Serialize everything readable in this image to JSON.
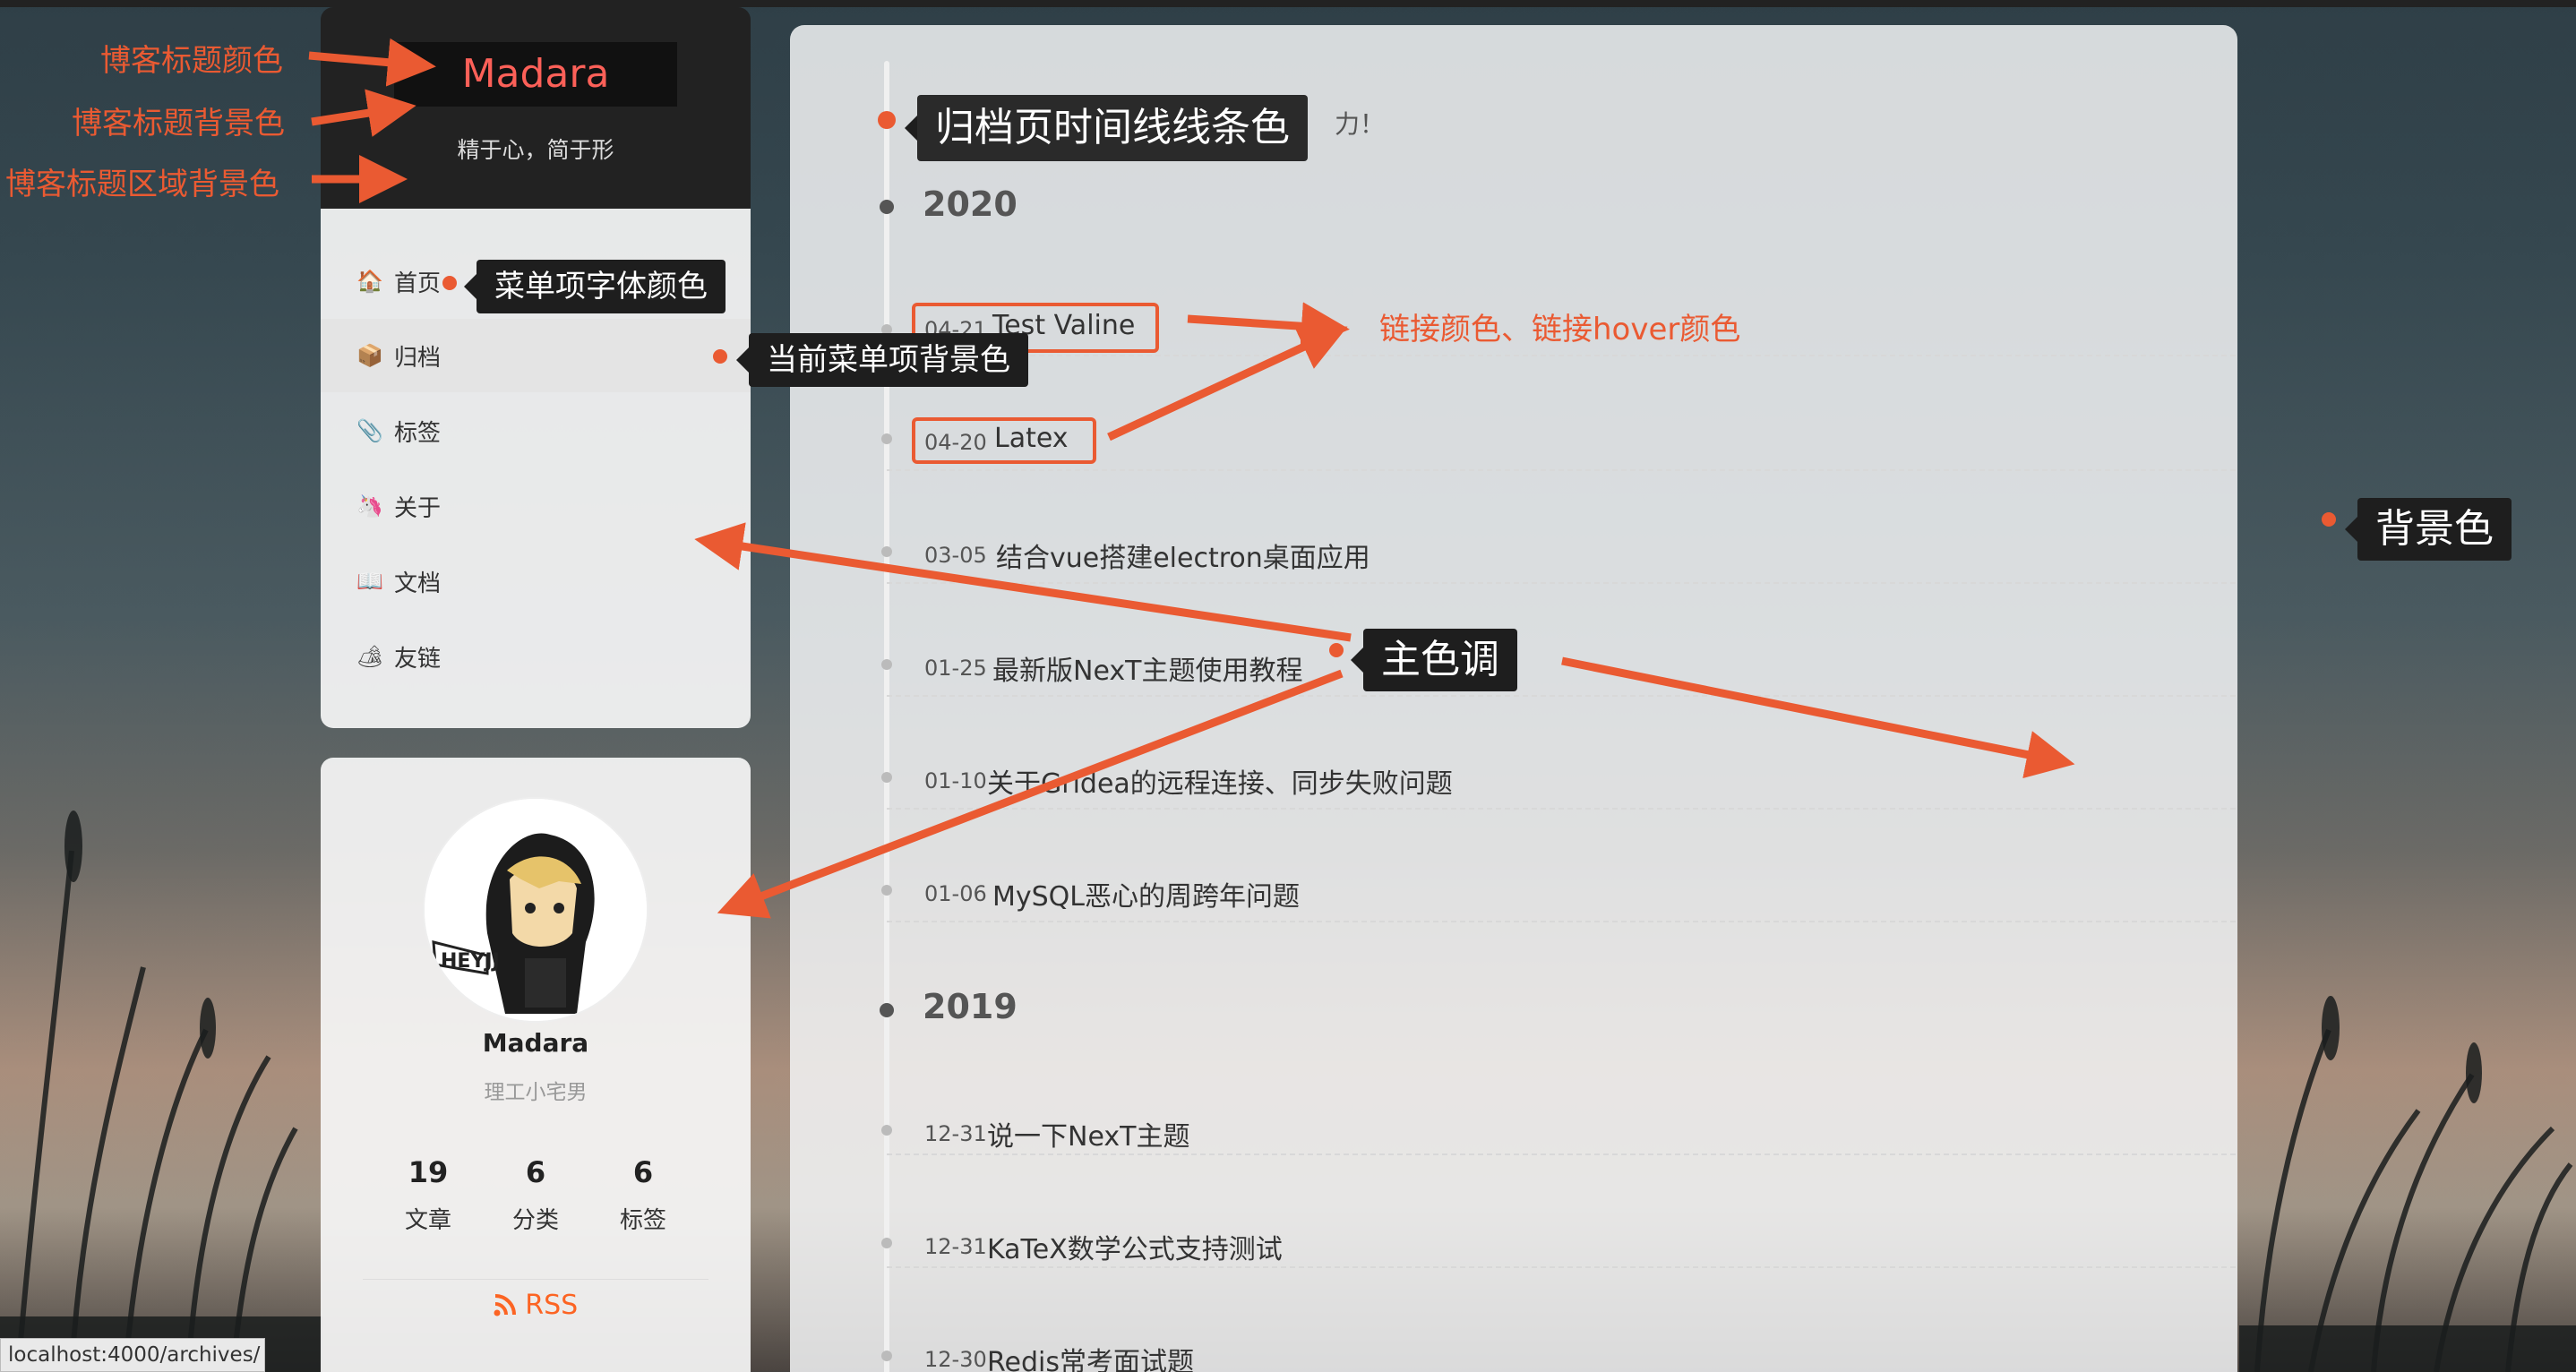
{
  "colors": {
    "accent": "#ea5a32",
    "brand_text": "#fc6058",
    "brand_bg": "#111111",
    "header_bg": "#222222",
    "link": "#fc6423"
  },
  "site": {
    "brand": "Madara",
    "subtitle": "精于心，简于形"
  },
  "menu": [
    {
      "icon": "house-icon",
      "glyph": "🏠",
      "label": "首页"
    },
    {
      "icon": "package-icon",
      "glyph": "📦",
      "label": "归档"
    },
    {
      "icon": "paperclip-icon",
      "glyph": "📎",
      "label": "标签"
    },
    {
      "icon": "unicorn-icon",
      "glyph": "🦄",
      "label": "关于"
    },
    {
      "icon": "book-icon",
      "glyph": "📖",
      "label": "文档"
    },
    {
      "icon": "camping-icon",
      "glyph": "🏕",
      "label": "友链"
    }
  ],
  "profile": {
    "name": "Madara",
    "description": "理工小宅男",
    "stats": [
      {
        "value": "19",
        "label": "文章"
      },
      {
        "value": "6",
        "label": "分类"
      },
      {
        "value": "6",
        "label": "标签"
      }
    ],
    "rss": "RSS"
  },
  "archive": {
    "intro": "力！",
    "years": [
      {
        "year": "2020",
        "posts": [
          {
            "date": "04-21",
            "title": "Test Valine"
          },
          {
            "date": "04-20",
            "title": "Latex"
          },
          {
            "date": "03-05",
            "title": "结合vue搭建electron桌面应用"
          },
          {
            "date": "01-25",
            "title": "最新版NexT主题使用教程"
          },
          {
            "date": "01-10",
            "title": "关于Gridea的远程连接、同步失败问题"
          },
          {
            "date": "01-06",
            "title": "MySQL恶心的周跨年问题"
          }
        ]
      },
      {
        "year": "2019",
        "posts": [
          {
            "date": "12-31",
            "title": "说一下NexT主题"
          },
          {
            "date": "12-31",
            "title": "KaTeX数学公式支持测试"
          },
          {
            "date": "12-30",
            "title": "Redis常考面试题"
          }
        ]
      }
    ]
  },
  "annotations": {
    "title_color": "博客标题颜色",
    "title_bg": "博客标题背景色",
    "title_area_bg": "博客标题区域背景色",
    "menu_font_color": "菜单项字体颜色",
    "current_menu_bg": "当前菜单项背景色",
    "timeline_color": "归档页时间线线条色",
    "link_color": "链接颜色、链接hover颜色",
    "background": "背景色",
    "main_tone": "主色调"
  },
  "status_bar": "localhost:4000/archives/"
}
